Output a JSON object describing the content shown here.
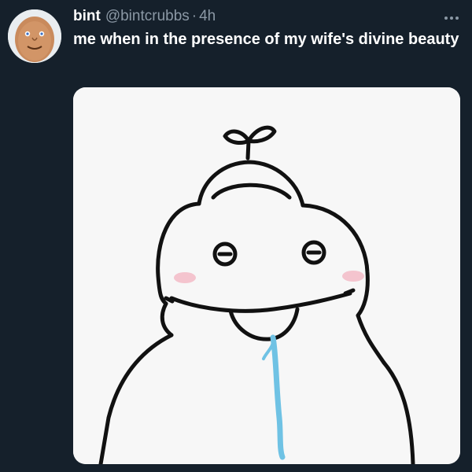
{
  "tweet": {
    "display_name": "bint",
    "handle": "@bintcrubbs",
    "separator": "·",
    "timestamp": "4h",
    "text": "me when in the presence of my wife's divine beauty",
    "more_icon": "more-horizontal-icon",
    "avatar_icon": "cartoon-face-avatar"
  },
  "colors": {
    "background": "#15202b",
    "text_primary": "#ffffff",
    "text_secondary": "#8b98a5"
  }
}
